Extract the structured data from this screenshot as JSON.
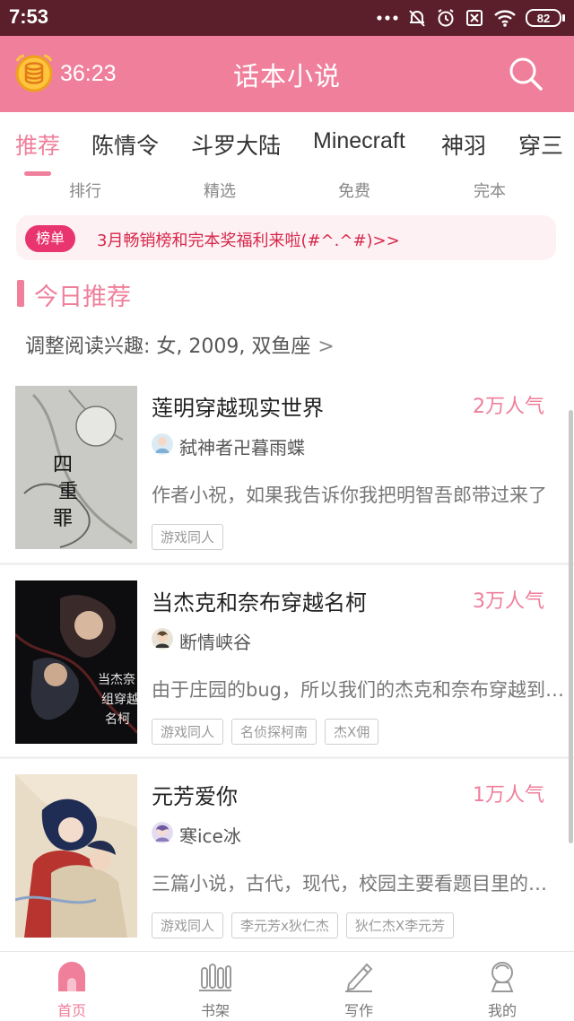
{
  "status_bar": {
    "time": "7:53",
    "battery": "82",
    "icons": [
      "more-dots-icon",
      "bell-off-icon",
      "alarm-clock-icon",
      "sim-off-icon",
      "wifi-icon",
      "battery-icon"
    ]
  },
  "app_bar": {
    "timer": "36:23",
    "title": "话本小说",
    "left_icon": "alarm-coin-icon",
    "right_icon": "search-icon"
  },
  "tabs": [
    {
      "label": "推荐",
      "active": true
    },
    {
      "label": "陈情令",
      "active": false
    },
    {
      "label": "斗罗大陆",
      "active": false
    },
    {
      "label": "Minecraft",
      "active": false
    },
    {
      "label": "神羽",
      "active": false
    },
    {
      "label": "穿三",
      "active": false
    }
  ],
  "sub_nav": [
    "排行",
    "精选",
    "免费",
    "完本"
  ],
  "notice": {
    "badge": "榜单",
    "text": "3月畅销榜和完本奖福利来啦(#^.^#)>>"
  },
  "section": {
    "title": "今日推荐",
    "interest": "调整阅读兴趣: 女, 2009, 双鱼座"
  },
  "books": [
    {
      "title": "莲明穿越现实世界",
      "popularity": "2万人气",
      "author": "弑神者卍暮雨蝶",
      "description": "作者小祝，如果我告诉你我把明智吾郎带过来了",
      "tags": [
        "游戏同人"
      ]
    },
    {
      "title": "当杰克和奈布穿越名柯",
      "popularity": "3万人气",
      "author": "断情峡谷",
      "description": "由于庄园的bug，所以我们的杰克和奈布穿越到了名柯",
      "tags": [
        "游戏同人",
        "名侦探柯南",
        "杰X佣"
      ]
    },
    {
      "title": "元芳爱你",
      "popularity": "1万人气",
      "author": "寒ice冰",
      "description": "三篇小说，古代，现代，校园主要看题目里的内容",
      "tags": [
        "游戏同人",
        "李元芳x狄仁杰",
        "狄仁杰X李元芳"
      ]
    }
  ],
  "bottom_nav": [
    {
      "label": "首页",
      "icon": "home-icon",
      "active": true
    },
    {
      "label": "书架",
      "icon": "bookshelf-icon",
      "active": false
    },
    {
      "label": "写作",
      "icon": "pencil-icon",
      "active": false
    },
    {
      "label": "我的",
      "icon": "profile-icon",
      "active": false
    }
  ],
  "colors": {
    "accent": "#ef7f9b",
    "status_bar": "#5a1f2a",
    "badge": "#e8356f",
    "notice_text": "#d7284a"
  }
}
